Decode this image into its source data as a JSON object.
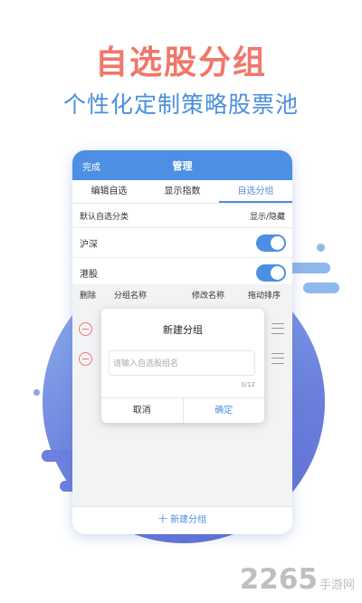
{
  "headline": "自选股分组",
  "subheadline": "个性化定制策略股票池",
  "nav": {
    "done": "完成",
    "title": "管理"
  },
  "tabs": [
    "编辑自选",
    "显示指数",
    "自选分组"
  ],
  "active_tab": 2,
  "header_row": {
    "left": "默认自选分类",
    "right": "显示/隐藏"
  },
  "rows": [
    {
      "label": "沪深",
      "enabled": true
    },
    {
      "label": "港股",
      "enabled": true
    }
  ],
  "columns": {
    "delete": "删除",
    "name": "分组名称",
    "rename": "修改名称",
    "sort": "拖动排序"
  },
  "dialog": {
    "title": "新建分组",
    "placeholder": "请输入自选股组名",
    "counter": "0/12",
    "cancel": "取消",
    "confirm": "确定"
  },
  "bottom_button": "十 新建分组",
  "watermark": {
    "number": "2265",
    "suffix": "手游网"
  },
  "colors": {
    "accent": "#4d8fe2",
    "headline": "#f0776b",
    "delete": "#f07a6c"
  }
}
